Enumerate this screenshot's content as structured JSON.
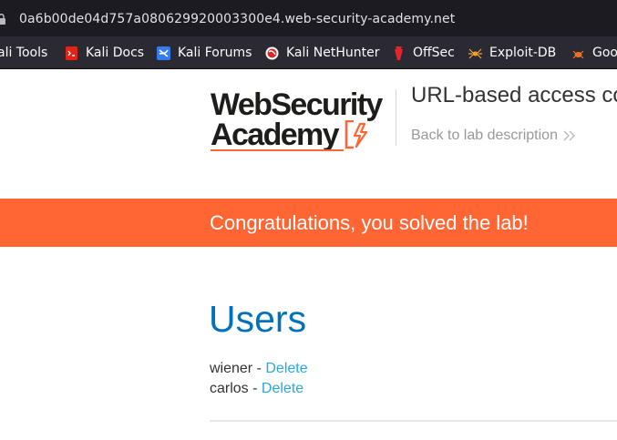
{
  "browser": {
    "url": "0a6b00de04d757a080629920003300e4.web-security-academy.net",
    "bookmarks": [
      {
        "label": "ali Tools",
        "icon": "kali-tools-icon"
      },
      {
        "label": "Kali Docs",
        "icon": "kali-docs-icon"
      },
      {
        "label": "Kali Forums",
        "icon": "kali-forums-icon"
      },
      {
        "label": "Kali NetHunter",
        "icon": "kali-nethunter-icon"
      },
      {
        "label": "OffSec",
        "icon": "offsec-icon"
      },
      {
        "label": "Exploit-DB",
        "icon": "exploit-db-icon"
      },
      {
        "label": "Goo",
        "icon": "google-hacking-db-icon"
      }
    ]
  },
  "header": {
    "logo_line1": "WebSecurity",
    "logo_line2": "Academy",
    "lab_title": "URL-based access co",
    "back_link": "Back to lab description"
  },
  "banner": {
    "message": "Congratulations, you solved the lab!"
  },
  "main": {
    "heading": "Users",
    "users": [
      {
        "name": "wiener",
        "separator": " - ",
        "action": "Delete"
      },
      {
        "name": "carlos",
        "separator": " - ",
        "action": "Delete"
      }
    ]
  },
  "colors": {
    "accent": "#ff6633",
    "heading": "#0071bc",
    "link": "#29a8e0",
    "browser_chrome": "#1c1b22",
    "bookmarks_bar": "#2b2a33"
  }
}
